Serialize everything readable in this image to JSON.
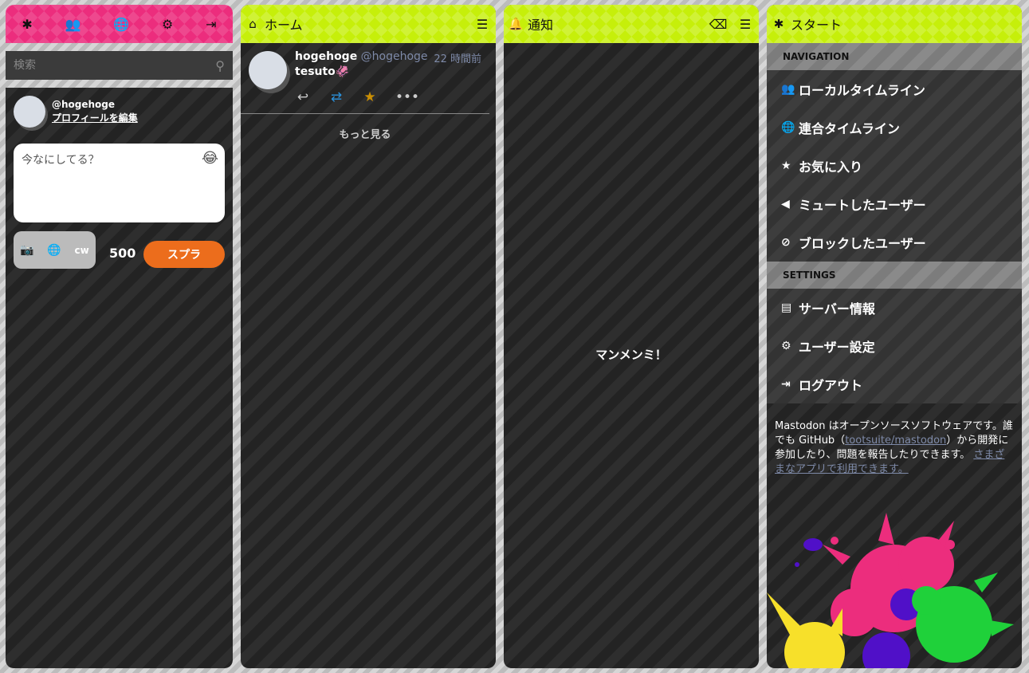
{
  "drawer": {
    "nav_icons": [
      "✱",
      "👥",
      "🌐",
      "⚙",
      "⇥"
    ],
    "search_placeholder": "検索",
    "account_handle": "@hogehoge",
    "edit_profile": "プロフィールを編集",
    "compose_placeholder": "今なにしてる？",
    "emoji_icon": "😂",
    "cw_label": "cw",
    "char_counter": "500",
    "publish_label": "スプラ"
  },
  "home": {
    "title": "ホーム",
    "status": {
      "display_name": "hogehoge",
      "acct": "@hogehoge",
      "time": "22 時間前",
      "content": "tesuto"
    },
    "load_more": "もっと見る"
  },
  "notifications": {
    "title": "通知",
    "empty_message": "マンメンミ！"
  },
  "start": {
    "title": "スタート",
    "navigation_label": "NAVIGATION",
    "navigation_items": [
      {
        "label": "ローカルタイムライン",
        "icon": "users-icon"
      },
      {
        "label": "連合タイムライン",
        "icon": "globe-icon"
      },
      {
        "label": "お気に入り",
        "icon": "star-icon"
      },
      {
        "label": "ミュートしたユーザー",
        "icon": "volume-off-icon"
      },
      {
        "label": "ブロックしたユーザー",
        "icon": "ban-icon"
      }
    ],
    "settings_label": "SETTINGS",
    "settings_items": [
      {
        "label": "サーバー情報",
        "icon": "book-icon"
      },
      {
        "label": "ユーザー設定",
        "icon": "cog-icon"
      },
      {
        "label": "ログアウト",
        "icon": "sign-out-icon"
      }
    ],
    "about_text_1": "Mastodon はオープンソースソフトウェアです。誰でも GitHub（",
    "about_link_repo": "tootsuite/mastodon",
    "about_text_2": "）から開発に参加したり、問題を報告したりできます。",
    "about_link_apps": "さまざまなアプリで利用できます。"
  },
  "colors": {
    "pink": "#ec2d7d",
    "lime": "#c6ef0a",
    "orange": "#ec6d1c",
    "splat_green": "#1fd13a",
    "splat_purple": "#5010c8",
    "splat_yellow": "#f7e02a"
  }
}
